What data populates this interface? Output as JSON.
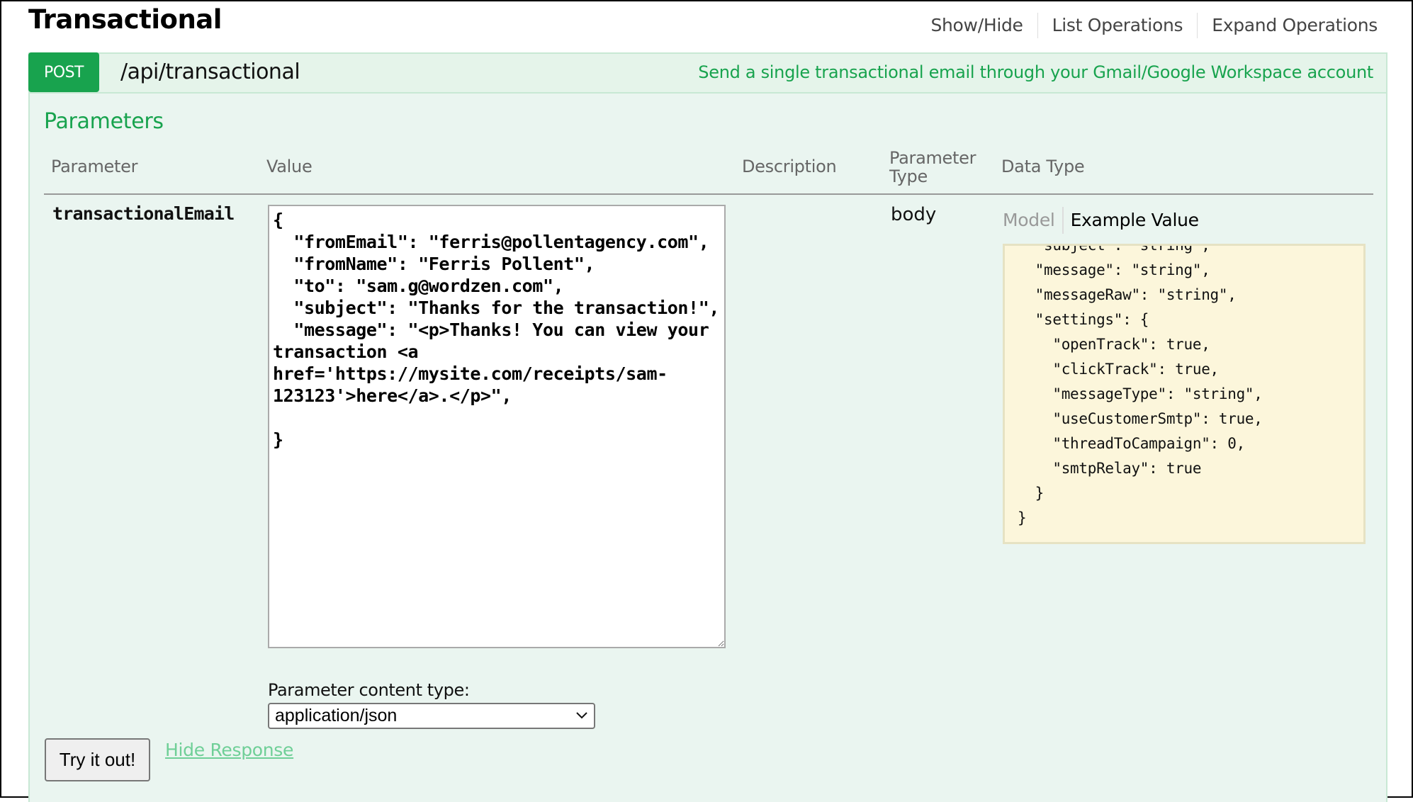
{
  "section": {
    "title": "Transactional",
    "nav": [
      "Show/Hide",
      "List Operations",
      "Expand Operations"
    ]
  },
  "operation": {
    "method": "POST",
    "path": "/api/transactional",
    "summary": "Send a single transactional email through your Gmail/Google Workspace account",
    "method_color": "#18a34e"
  },
  "parameters": {
    "heading": "Parameters",
    "columns": {
      "parameter": "Parameter",
      "value": "Value",
      "description": "Description",
      "parameter_type": "Parameter Type",
      "data_type": "Data Type"
    },
    "rows": [
      {
        "name": "transactionalEmail",
        "value": "{\n  \"fromEmail\": \"ferris@pollentagency.com\",\n  \"fromName\": \"Ferris Pollent\",\n  \"to\": \"sam.g@wordzen.com\",\n  \"subject\": \"Thanks for the transaction!\",\n  \"message\": \"<p>Thanks! You can view your transaction <a href='https://mysite.com/receipts/sam-123123'>here</a>.</p>\",\n\n}",
        "description": "",
        "parameter_type": "body",
        "data_type": {
          "tabs": [
            "Model",
            "Example Value"
          ],
          "active_tab": "Example Value",
          "example_value": "  \"subject\": \"string\",\n  \"message\": \"string\",\n  \"messageRaw\": \"string\",\n  \"settings\": {\n    \"openTrack\": true,\n    \"clickTrack\": true,\n    \"messageType\": \"string\",\n    \"useCustomerSmtp\": true,\n    \"threadToCampaign\": 0,\n    \"smtpRelay\": true\n  }\n}"
        }
      }
    ],
    "content_type_label": "Parameter content type:",
    "content_type_selected": "application/json"
  },
  "actions": {
    "try_label": "Try it out!",
    "hide_response_label": "Hide Response"
  },
  "icons": {
    "select_chevron": "chevron-down-icon",
    "resize_handle": "resize-grip-icon"
  }
}
